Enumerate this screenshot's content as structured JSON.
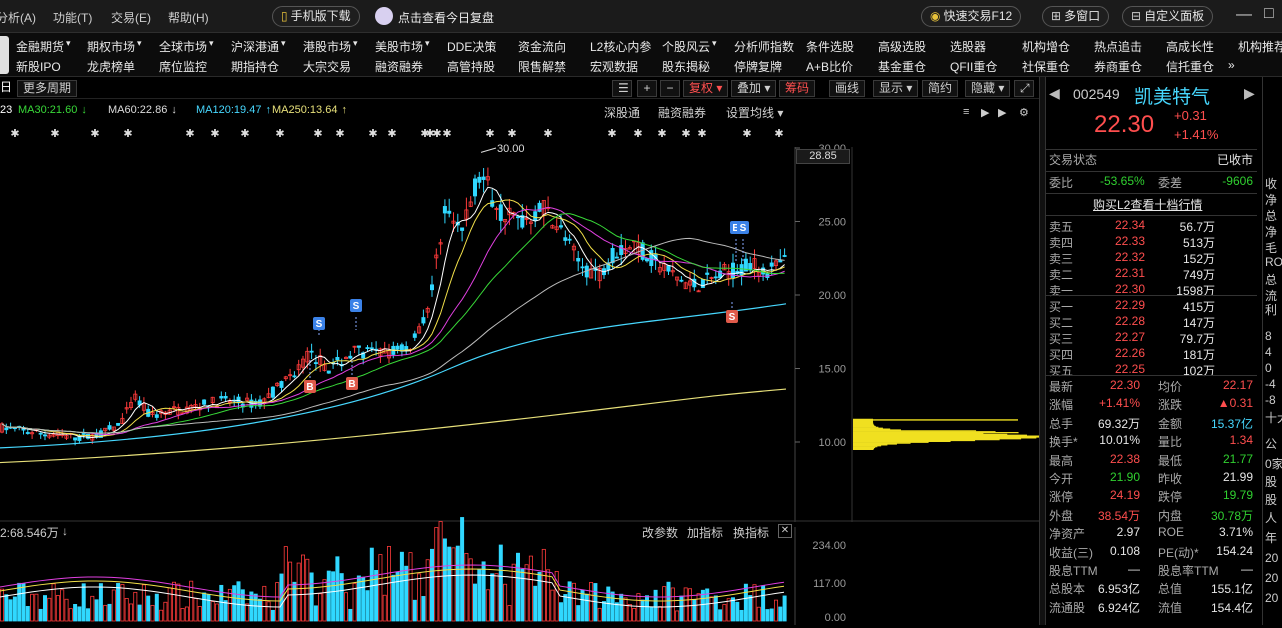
{
  "menubar": {
    "items": [
      "分析(A)",
      "功能(T)",
      "交易(E)",
      "帮助(H)"
    ],
    "mobile_download": "手机版下载",
    "review_link": "点击查看今日复盘",
    "quick_trade": "快速交易F12",
    "multi_window": "多窗口",
    "custom_panel": "自定义面板"
  },
  "nav": {
    "row1": [
      "金融期货",
      "期权市场",
      "全球市场",
      "沪深港通",
      "港股市场",
      "美股市场",
      "DDE决策",
      "资金流向",
      "L2核心内参",
      "个股风云",
      "分析师指数",
      "条件选股",
      "高级选股",
      "选股器",
      "机构增仓",
      "热点追击",
      "高成长性",
      "机构推荐"
    ],
    "row2": [
      "新股IPO",
      "龙虎榜单",
      "席位监控",
      "期指持仓",
      "大宗交易",
      "融资融券",
      "高管持股",
      "限售解禁",
      "宏观数据",
      "股东揭秘",
      "停牌复牌",
      "A+B比价",
      "基金重仓",
      "QFII重仓",
      "社保重仓",
      "券商重仓",
      "信托重仓",
      "»"
    ]
  },
  "chart_toolbar": {
    "period_prefix": "日",
    "more_periods": "更多周期",
    "adjust": "复权",
    "overlay": "叠加",
    "chip": "筹码",
    "draw": "画线",
    "display": "显示",
    "simple": "简约",
    "hide": "隐藏",
    "deep_link": "深股通",
    "margin": "融资融券",
    "settings": "设置均线"
  },
  "ma_legend": [
    {
      "label": "23",
      "color": "#ffffff"
    },
    {
      "label": "MA30:21.60",
      "color": "#38d838",
      "arrow": "↓"
    },
    {
      "label": "MA60:22.86",
      "color": "#dcdcdc",
      "arrow": "↓"
    },
    {
      "label": "MA120:19.47",
      "color": "#47d8ff",
      "arrow": "↑"
    },
    {
      "label": "MA250:13.64",
      "color": "#e7e07a",
      "arrow": "↑"
    }
  ],
  "price_axis": {
    "ticks": [
      "30.00",
      "25.00",
      "20.00",
      "15.00",
      "10.00"
    ],
    "current": "28.85"
  },
  "chart_annotations": {
    "high_label": "30.00",
    "signals": [
      "S",
      "S",
      "B",
      "B",
      "B",
      "S",
      "S"
    ]
  },
  "volume": {
    "header": "2:68.546万",
    "arrow": "↓",
    "buttons": [
      "改参数",
      "加指标",
      "换指标"
    ],
    "axis_ticks": [
      "234.00",
      "117.00",
      "0.00"
    ]
  },
  "quote": {
    "code": "002549",
    "name": "凯美特气",
    "price": "22.30",
    "change": "+0.31",
    "change_pct": "+1.41%",
    "trade_status_label": "交易状态",
    "trade_status": "已收市",
    "weibi_label": "委比",
    "weibi": "-53.65%",
    "weicha_label": "委差",
    "weicha": "-9606",
    "l2_link": "购买L2查看十档行情",
    "asks": [
      {
        "label": "卖五",
        "price": "22.34",
        "vol": "56.7万"
      },
      {
        "label": "卖四",
        "price": "22.33",
        "vol": "513万"
      },
      {
        "label": "卖三",
        "price": "22.32",
        "vol": "152万"
      },
      {
        "label": "卖二",
        "price": "22.31",
        "vol": "749万"
      },
      {
        "label": "卖一",
        "price": "22.30",
        "vol": "1598万"
      }
    ],
    "bids": [
      {
        "label": "买一",
        "price": "22.29",
        "vol": "415万"
      },
      {
        "label": "买二",
        "price": "22.28",
        "vol": "147万"
      },
      {
        "label": "买三",
        "price": "22.27",
        "vol": "79.7万"
      },
      {
        "label": "买四",
        "price": "22.26",
        "vol": "181万"
      },
      {
        "label": "买五",
        "price": "22.25",
        "vol": "102万"
      }
    ],
    "stats": [
      {
        "l1": "最新",
        "v1": "22.30",
        "c1": "red",
        "l2": "均价",
        "v2": "22.17",
        "c2": "red"
      },
      {
        "l1": "涨幅",
        "v1": "+1.41%",
        "c1": "red",
        "l2": "涨跌",
        "v2": "▲0.31",
        "c2": "red"
      },
      {
        "l1": "总手",
        "v1": "69.32万",
        "c1": "white",
        "l2": "金额",
        "v2": "15.37亿",
        "c2": "cyan"
      },
      {
        "l1": "换手*",
        "v1": "10.01%",
        "c1": "white",
        "l2": "量比",
        "v2": "1.34",
        "c2": "red"
      },
      {
        "l1": "最高",
        "v1": "22.38",
        "c1": "red",
        "l2": "最低",
        "v2": "21.77",
        "c2": "green"
      },
      {
        "l1": "今开",
        "v1": "21.90",
        "c1": "green",
        "l2": "昨收",
        "v2": "21.99",
        "c2": "white"
      },
      {
        "l1": "涨停",
        "v1": "24.19",
        "c1": "red",
        "l2": "跌停",
        "v2": "19.79",
        "c2": "green"
      },
      {
        "l1": "外盘",
        "v1": "38.54万",
        "c1": "red",
        "l2": "内盘",
        "v2": "30.78万",
        "c2": "green"
      },
      {
        "l1": "净资产",
        "v1": "2.97",
        "c1": "white",
        "l2": "ROE",
        "v2": "3.71%",
        "c2": "white"
      },
      {
        "l1": "收益(三)",
        "v1": "0.108",
        "c1": "white",
        "l2": "PE(动)*",
        "v2": "154.24",
        "c2": "white"
      },
      {
        "l1": "股息TTM",
        "v1": "—",
        "c1": "white",
        "l2": "股息率TTM",
        "v2": "—",
        "c2": "white"
      },
      {
        "l1": "总股本",
        "v1": "6.953亿",
        "c1": "white",
        "l2": "总值",
        "v2": "155.1亿",
        "c2": "white"
      },
      {
        "l1": "流通股",
        "v1": "6.924亿",
        "c1": "white",
        "l2": "流值",
        "v2": "154.4亿",
        "c2": "white"
      }
    ]
  },
  "far_right": [
    "收",
    "净",
    "总",
    "净",
    "毛",
    "RO",
    "总",
    "流",
    "利",
    "8",
    "4",
    "0",
    "-4",
    "-8",
    "十大",
    "公",
    "0家",
    "股",
    "股",
    "人",
    "年",
    "20",
    "20",
    "20"
  ]
}
